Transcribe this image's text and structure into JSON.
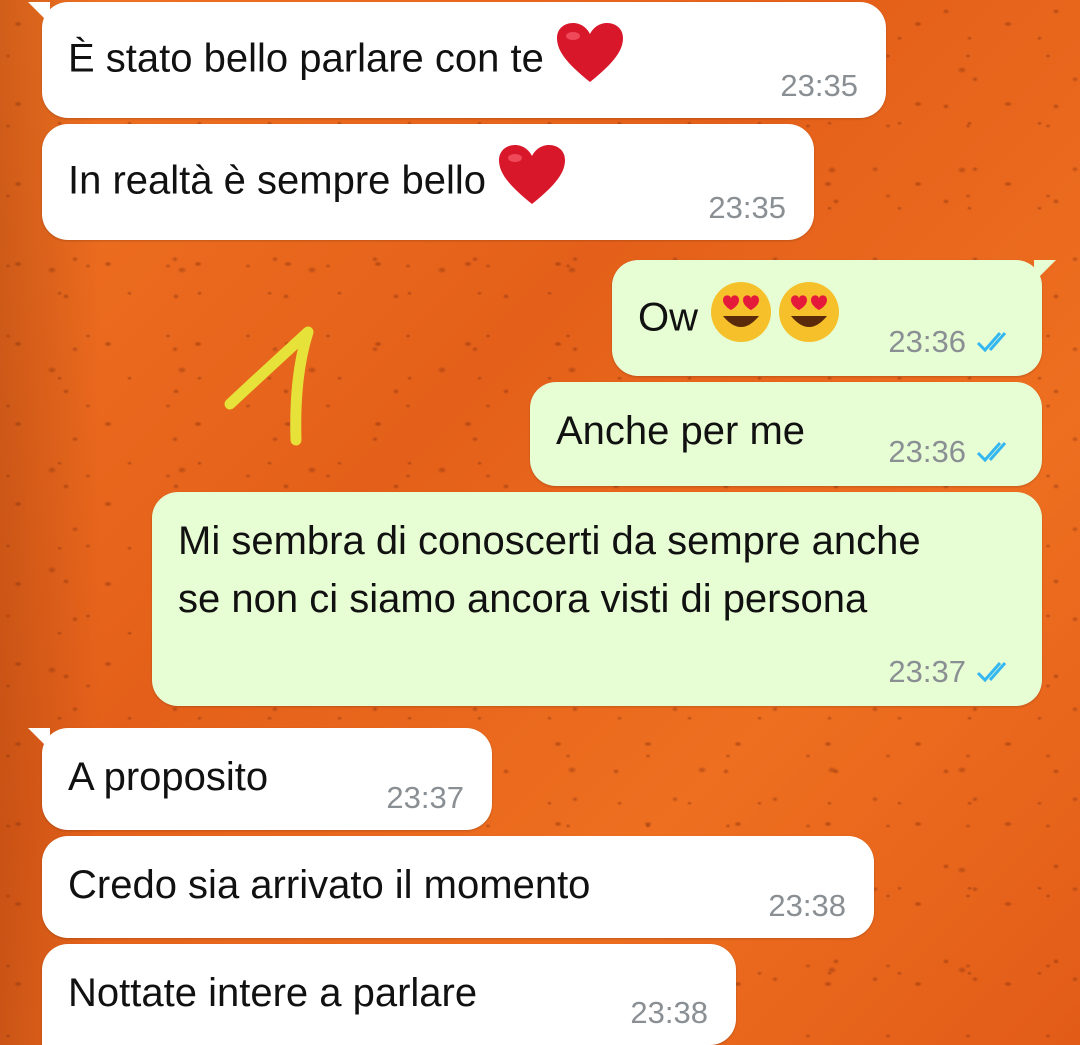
{
  "chat": {
    "messages": [
      {
        "direction": "incoming",
        "text": "È stato bello parlare con te",
        "emoji": "heart-emoji",
        "time": "23:35"
      },
      {
        "direction": "incoming",
        "text": "In realtà è sempre bello",
        "emoji": "heart-emoji",
        "time": "23:35"
      },
      {
        "direction": "outgoing",
        "text": "Ow",
        "emoji": "heart-eyes-emoji x2",
        "time": "23:36",
        "status": "read"
      },
      {
        "direction": "outgoing",
        "text": "Anche per me",
        "time": "23:36",
        "status": "read"
      },
      {
        "direction": "outgoing",
        "text": "Mi sembra di conoscerti da sempre anche se non ci siamo ancora visti di persona",
        "time": "23:37",
        "status": "read"
      },
      {
        "direction": "incoming",
        "text": "A proposito",
        "time": "23:37"
      },
      {
        "direction": "incoming",
        "text": "Credo sia arrivato il momento",
        "time": "23:38"
      },
      {
        "direction": "incoming",
        "text": "Nottate intere a parlare",
        "time": "23:38"
      }
    ]
  },
  "annotation": {
    "label": "1",
    "color": "#e6e23a"
  },
  "colors": {
    "incoming_bubble": "#ffffff",
    "outgoing_bubble": "#e7fdd3",
    "read_ticks": "#34b7f1",
    "wallpaper": "#e8621c"
  }
}
